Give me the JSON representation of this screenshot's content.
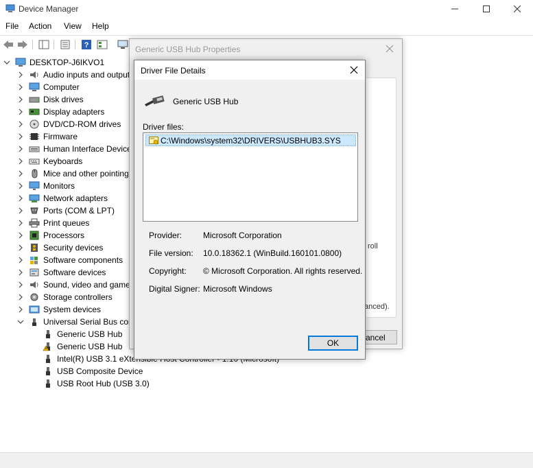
{
  "window": {
    "title": "Device Manager"
  },
  "menu": [
    "File",
    "Action",
    "View",
    "Help"
  ],
  "tree": {
    "root": "DESKTOP-J6IKVO1",
    "categories": [
      {
        "label": "Audio inputs and outputs",
        "icon": "speaker-icon"
      },
      {
        "label": "Computer",
        "icon": "computer-icon"
      },
      {
        "label": "Disk drives",
        "icon": "disk-drive-icon"
      },
      {
        "label": "Display adapters",
        "icon": "display-adapter-icon"
      },
      {
        "label": "DVD/CD-ROM drives",
        "icon": "dvd-drive-icon"
      },
      {
        "label": "Firmware",
        "icon": "firmware-icon"
      },
      {
        "label": "Human Interface Devices",
        "icon": "hid-icon"
      },
      {
        "label": "Keyboards",
        "icon": "keyboard-icon"
      },
      {
        "label": "Mice and other pointing devices",
        "icon": "mouse-icon"
      },
      {
        "label": "Monitors",
        "icon": "monitor-icon"
      },
      {
        "label": "Network adapters",
        "icon": "network-adapter-icon"
      },
      {
        "label": "Ports (COM & LPT)",
        "icon": "port-icon"
      },
      {
        "label": "Print queues",
        "icon": "printer-icon"
      },
      {
        "label": "Processors",
        "icon": "processor-icon"
      },
      {
        "label": "Security devices",
        "icon": "security-device-icon"
      },
      {
        "label": "Software components",
        "icon": "software-component-icon"
      },
      {
        "label": "Software devices",
        "icon": "software-device-icon"
      },
      {
        "label": "Sound, video and game controllers",
        "icon": "sound-icon"
      },
      {
        "label": "Storage controllers",
        "icon": "storage-controller-icon"
      },
      {
        "label": "System devices",
        "icon": "system-device-icon"
      },
      {
        "label": "Universal Serial Bus controllers",
        "icon": "usb-icon"
      }
    ],
    "usb_children": [
      {
        "label": "Generic USB Hub",
        "warning": false
      },
      {
        "label": "Generic USB Hub",
        "warning": true
      },
      {
        "label": "Intel(R) USB 3.1 eXtensible Host Controller - 1.10 (Microsoft)",
        "warning": false
      },
      {
        "label": "USB Composite Device",
        "warning": false
      },
      {
        "label": "USB Root Hub (USB 3.0)",
        "warning": false
      }
    ]
  },
  "properties_dialog": {
    "title": "Generic USB Hub Properties",
    "partial_text_1": "roll",
    "partial_text_2": "anced).",
    "cancel_partial": "ancel"
  },
  "driver_details": {
    "title": "Driver File Details",
    "device_name": "Generic USB Hub",
    "files_label": "Driver files:",
    "files": [
      "C:\\Windows\\system32\\DRIVERS\\USBHUB3.SYS"
    ],
    "provider_label": "Provider:",
    "provider": "Microsoft Corporation",
    "version_label": "File version:",
    "version": "10.0.18362.1 (WinBuild.160101.0800)",
    "copyright_label": "Copyright:",
    "copyright": "© Microsoft Corporation. All rights reserved.",
    "signer_label": "Digital Signer:",
    "signer": "Microsoft Windows",
    "ok_label": "OK"
  },
  "colors": {
    "accent": "#0078d7",
    "selection": "#cce8ff",
    "warning": "#f2b600"
  }
}
